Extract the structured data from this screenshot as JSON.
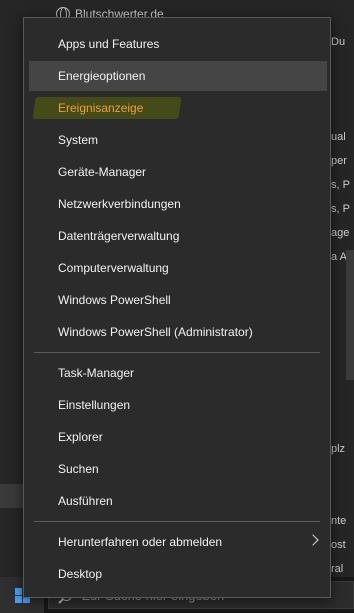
{
  "background": {
    "top_link": "Blutschwerter.de",
    "right_fragments": [
      "Du",
      "ual",
      "per",
      "s, P",
      "s, P",
      "age",
      "a A",
      "plz",
      "nte",
      "ost",
      "ral"
    ]
  },
  "taskbar": {
    "search_placeholder": "Zur Suche hier eingeben"
  },
  "menu": {
    "items": [
      {
        "label": "Apps und Features"
      },
      {
        "label": "Energieoptionen"
      },
      {
        "label": "Ereignisanzeige"
      },
      {
        "label": "System"
      },
      {
        "label": "Geräte-Manager"
      },
      {
        "label": "Netzwerkverbindungen"
      },
      {
        "label": "Datenträgerverwaltung"
      },
      {
        "label": "Computerverwaltung"
      },
      {
        "label": "Windows PowerShell"
      },
      {
        "label": "Windows PowerShell (Administrator)"
      },
      {
        "label": "Task-Manager"
      },
      {
        "label": "Einstellungen"
      },
      {
        "label": "Explorer"
      },
      {
        "label": "Suchen"
      },
      {
        "label": "Ausführen"
      },
      {
        "label": "Herunterfahren oder abmelden"
      },
      {
        "label": "Desktop"
      }
    ],
    "hovered_item": "Energieoptionen",
    "highlighted_item": "Ereignisanzeige",
    "highlight_color": "#f0a030"
  }
}
